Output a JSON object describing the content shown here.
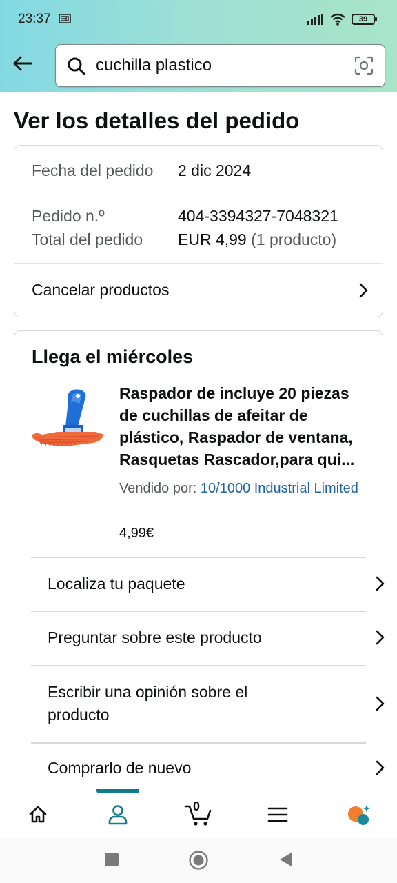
{
  "status_bar": {
    "time": "23:37",
    "battery": "39"
  },
  "search": {
    "query": "cuchilla plastico"
  },
  "page": {
    "title": "Ver los detalles del pedido"
  },
  "order_info": {
    "date_label": "Fecha del pedido",
    "date_value": "2 dic 2024",
    "number_label": "Pedido n.º",
    "number_value": "404-3394327-7048321",
    "total_label": "Total del pedido",
    "total_value": "EUR 4,99",
    "total_count": "(1 producto)",
    "cancel_label": "Cancelar productos"
  },
  "shipment": {
    "title": "Llega el miércoles",
    "product_title": "Raspador de incluye 20 piezas de cuchillas de afeitar de plástico, Raspador de ventana, Rasquetas Rascador,para qui...",
    "seller_prefix": "Vendido por:",
    "seller_name": "10/1000 Industrial Limited",
    "price": "4,99€",
    "actions": [
      "Localiza tu paquete",
      "Preguntar sobre este producto",
      "Escribir una opinión sobre el producto",
      "Comprarlo de nuevo"
    ]
  },
  "bottom_nav": {
    "cart_count": "0",
    "icons": [
      "home-icon",
      "account-icon",
      "cart-icon",
      "menu-icon",
      "rufus-icon"
    ],
    "active": "account-icon"
  },
  "colors": {
    "accent": "#137a8a",
    "link": "#2162a1",
    "header_start": "#83d9e3",
    "header_end": "#a8e4c8"
  }
}
